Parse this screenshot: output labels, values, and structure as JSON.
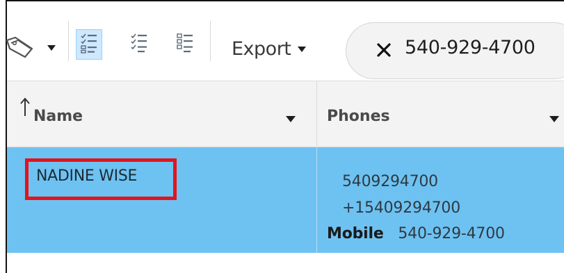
{
  "toolbar": {
    "tag_icon": "tag-icon",
    "view_buttons": [
      {
        "icon": "checklist-view-icon",
        "active": true
      },
      {
        "icon": "checklist-alt-view-icon",
        "active": false
      },
      {
        "icon": "list-view-icon",
        "active": false
      }
    ],
    "export_label": "Export",
    "search": {
      "clear_icon": "close-icon",
      "value": "540-929-4700"
    }
  },
  "grid": {
    "columns": [
      {
        "label": "Name",
        "sort": "ascending"
      },
      {
        "label": "Phones"
      }
    ],
    "rows": [
      {
        "name": "NADINE WISE",
        "selected": true,
        "highlighted": true,
        "phones": [
          {
            "number": "5409294700"
          },
          {
            "number": "+15409294700"
          },
          {
            "type": "Mobile",
            "number": "540-929-4700"
          }
        ]
      }
    ]
  },
  "colors": {
    "selected_row": "#6ec2f2",
    "highlight_border": "#e3141c",
    "active_view": "#cde8ff"
  }
}
